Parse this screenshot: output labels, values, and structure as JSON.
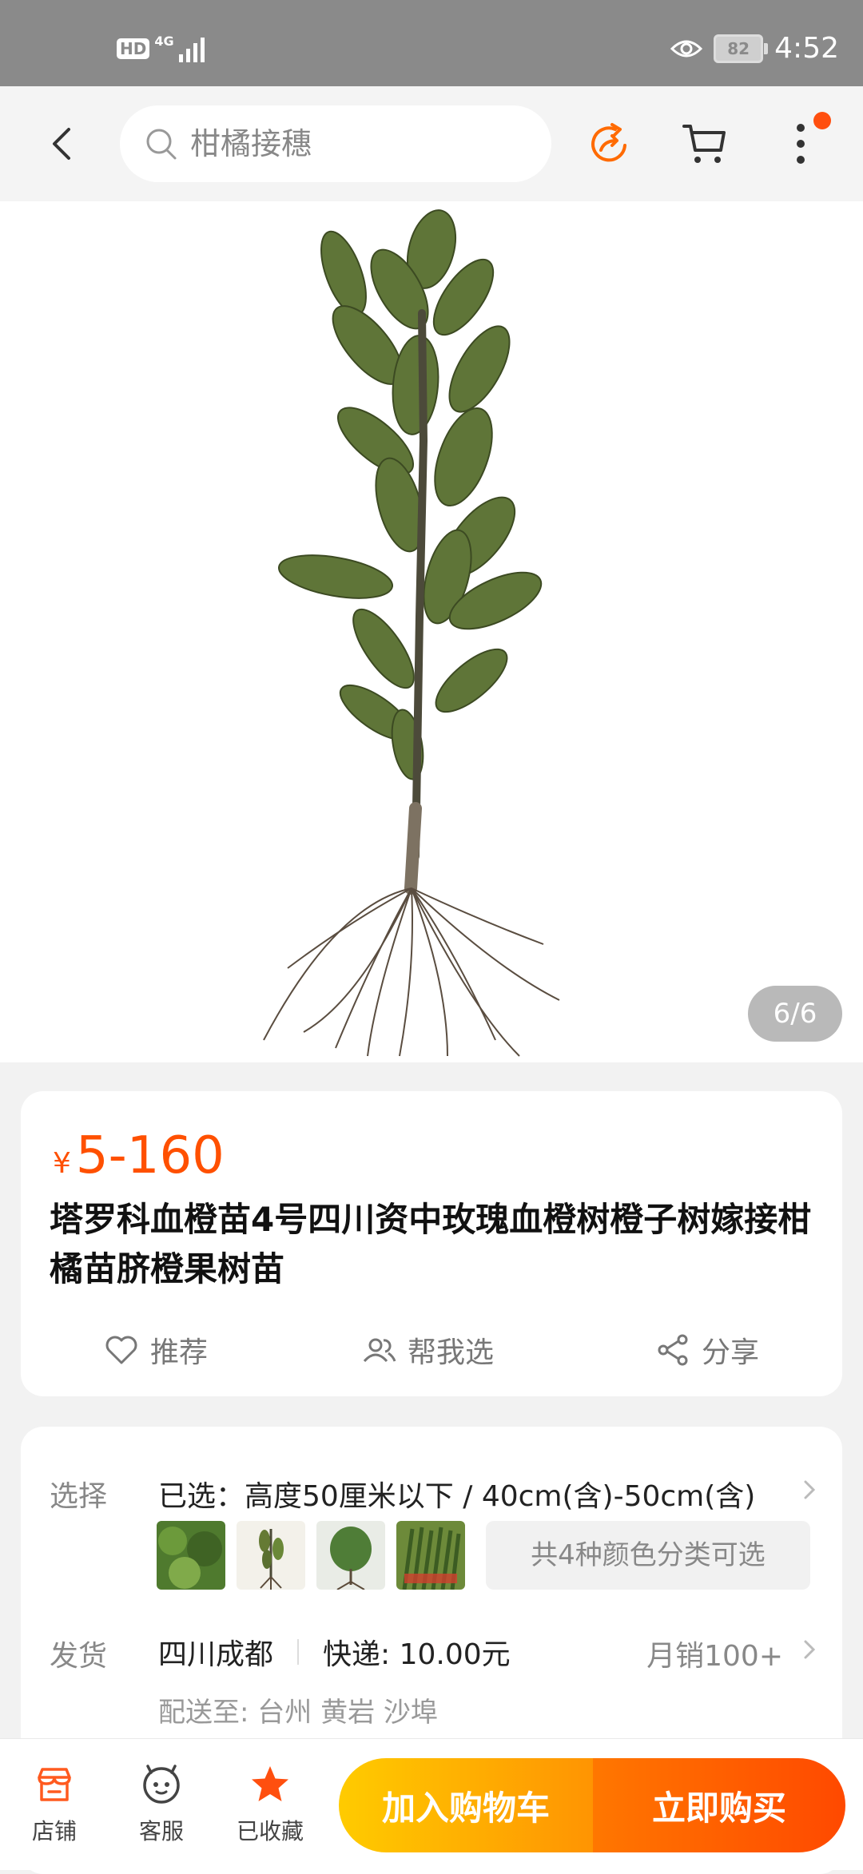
{
  "status_bar": {
    "hd": "HD",
    "network": "4G",
    "battery": "82",
    "time": "4:52"
  },
  "search": {
    "placeholder": "柑橘接穗"
  },
  "icons": {
    "back": "back-arrow-icon",
    "search": "search-icon",
    "share": "share-circle-icon",
    "cart": "cart-icon",
    "more": "more-vertical-icon"
  },
  "gallery": {
    "counter": "6/6"
  },
  "product": {
    "currency": "¥",
    "price": "5-160",
    "title": "塔罗科血橙苗4号四川资中玫瑰血橙树橙子树嫁接柑橘苗脐橙果树苗"
  },
  "actions": {
    "recommend": "推荐",
    "help_choose": "帮我选",
    "share": "分享"
  },
  "options": {
    "select_label": "选择",
    "selected_text": "已选：高度50厘米以下 / 40cm(含)-50cm(含)",
    "variants_text": "共4种颜色分类可选",
    "ship_label": "发货",
    "ship_from": "四川成都",
    "express": "快递: 10.00元",
    "monthly_sales": "月销100+",
    "deliver_to": "配送至: 台州 黄岩 沙埠"
  },
  "bottom_bar": {
    "store": "店铺",
    "service": "客服",
    "favorited": "已收藏",
    "add_to_cart": "加入购物车",
    "buy_now": "立即购买"
  },
  "colors": {
    "accent": "#ff5000",
    "cart_gradient_start": "#ffcb00",
    "buy_gradient_end": "#ff4900"
  }
}
